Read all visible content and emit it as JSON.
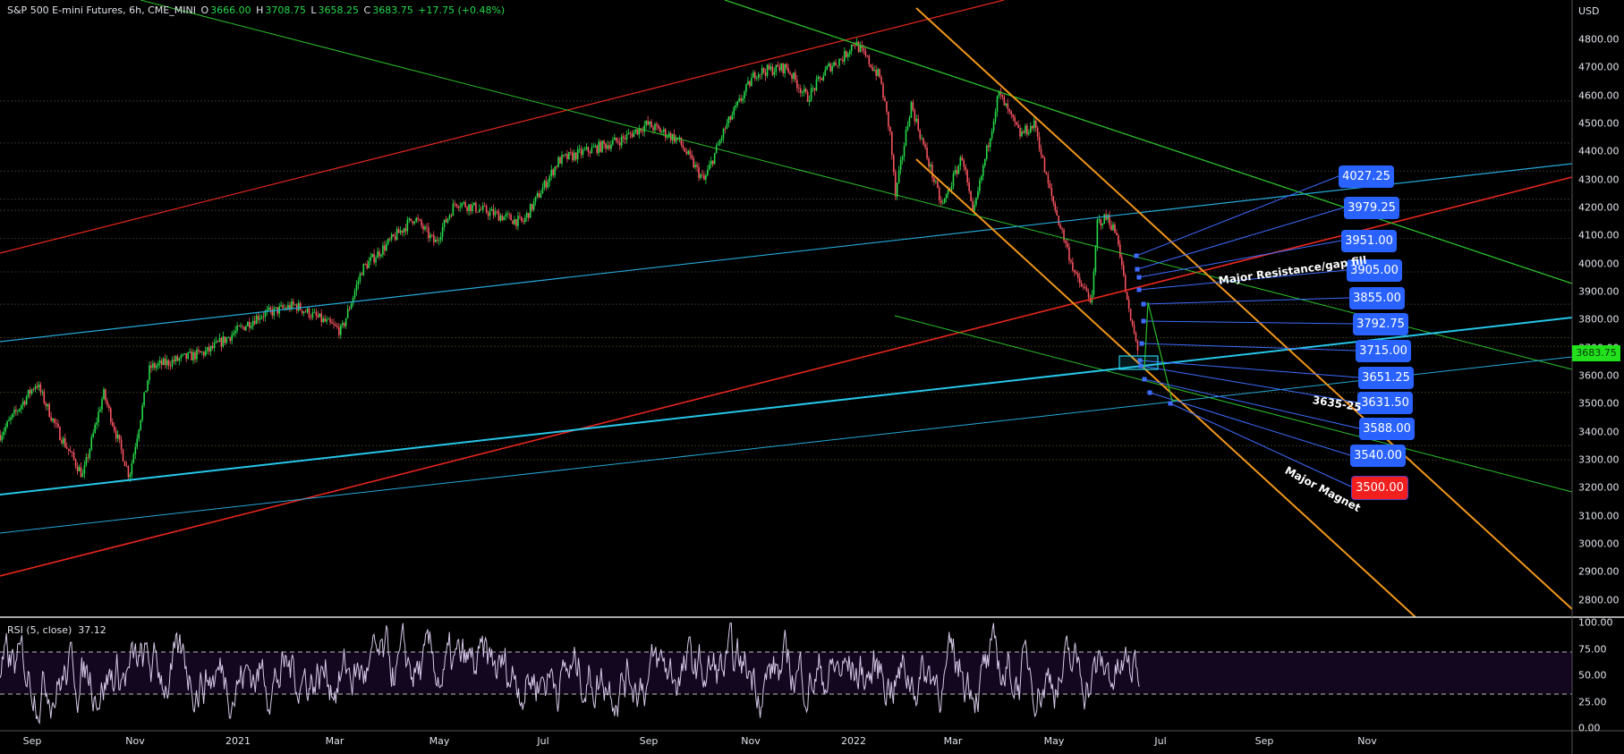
{
  "header": {
    "symbol": "S&P 500 E-mini Futures, 6h, CME_MINI",
    "o_label": "O",
    "o": "3666.00",
    "h_label": "H",
    "h": "3708.75",
    "l_label": "L",
    "l": "3658.25",
    "c_label": "C",
    "c": "3683.75",
    "change": "+17.75 (+0.48%)"
  },
  "price_axis": {
    "currency": "USD",
    "labels": [
      "4800.00",
      "4700.00",
      "4600.00",
      "4500.00",
      "4400.00",
      "4300.00",
      "4200.00",
      "4100.00",
      "4000.00",
      "3900.00",
      "3800.00",
      "3700.00",
      "3600.00",
      "3500.00",
      "3400.00",
      "3300.00",
      "3200.00",
      "3100.00",
      "3000.00",
      "2900.00",
      "2800.00"
    ],
    "current_price": "3683.75"
  },
  "rsi_axis": {
    "labels": [
      "100.00",
      "75.00",
      "50.00",
      "25.00",
      "0.00"
    ]
  },
  "time_axis": {
    "labels": [
      "Sep",
      "Nov",
      "2021",
      "Mar",
      "May",
      "Jul",
      "Sep",
      "Nov",
      "2022",
      "Mar",
      "May",
      "Jul",
      "Sep",
      "Nov"
    ]
  },
  "rsi": {
    "legend": "RSI (5, close)",
    "value": "37.12"
  },
  "price_boxes": [
    {
      "label": "4027.25",
      "color": "#2962ff"
    },
    {
      "label": "3979.25",
      "color": "#2962ff"
    },
    {
      "label": "3951.00",
      "color": "#2962ff"
    },
    {
      "label": "3905.00",
      "color": "#2962ff"
    },
    {
      "label": "3855.00",
      "color": "#2962ff"
    },
    {
      "label": "3792.75",
      "color": "#2962ff"
    },
    {
      "label": "3715.00",
      "color": "#2962ff"
    },
    {
      "label": "3651.25",
      "color": "#2962ff"
    },
    {
      "label": "3631.50",
      "color": "#2962ff"
    },
    {
      "label": "3588.00",
      "color": "#2962ff"
    },
    {
      "label": "3540.00",
      "color": "#2962ff"
    },
    {
      "label": "3500.00",
      "color": "#f21f1f"
    }
  ],
  "annotations": {
    "resistance": "Major Resistance/gap fill",
    "zone": "3635-25",
    "magnet": "Major Magnet"
  },
  "colors": {
    "up": "#26d94a",
    "down": "#f7525f",
    "rsi": "#d6c8e8",
    "band": "#12071f",
    "accent": "#2962ff"
  },
  "chart_data": {
    "type": "candlestick",
    "title": "S&P 500 E-mini Futures, 6h, CME_MINI",
    "ylabel": "USD",
    "ylim": [
      2750,
      4900
    ],
    "x_unit": "months since Sep 2020",
    "price_path": [
      [
        -0.62,
        3389
      ],
      [
        0.08,
        3574
      ],
      [
        0.48,
        3408
      ],
      [
        0.98,
        3242
      ],
      [
        1.38,
        3537
      ],
      [
        1.88,
        3242
      ],
      [
        2.28,
        3629
      ],
      [
        3.39,
        3685
      ],
      [
        4.39,
        3814
      ],
      [
        5.09,
        3851
      ],
      [
        5.99,
        3759
      ],
      [
        6.39,
        3980
      ],
      [
        7.4,
        4165
      ],
      [
        7.8,
        4073
      ],
      [
        8.2,
        4220
      ],
      [
        9.5,
        4146
      ],
      [
        10.2,
        4368
      ],
      [
        11.41,
        4442
      ],
      [
        11.91,
        4497
      ],
      [
        12.51,
        4442
      ],
      [
        13.01,
        4294
      ],
      [
        13.41,
        4479
      ],
      [
        14.01,
        4682
      ],
      [
        14.61,
        4700
      ],
      [
        15.01,
        4590
      ],
      [
        15.42,
        4700
      ],
      [
        15.72,
        4737
      ],
      [
        15.92,
        4793
      ],
      [
        16.42,
        4664
      ],
      [
        16.62,
        4460
      ],
      [
        16.72,
        4239
      ],
      [
        17.02,
        4571
      ],
      [
        17.62,
        4202
      ],
      [
        18.02,
        4386
      ],
      [
        18.22,
        4165
      ],
      [
        18.72,
        4608
      ],
      [
        18.92,
        4534
      ],
      [
        19.13,
        4460
      ],
      [
        19.43,
        4497
      ],
      [
        19.63,
        4313
      ],
      [
        19.83,
        4183
      ],
      [
        20.23,
        3943
      ],
      [
        20.53,
        3869
      ],
      [
        20.63,
        4146
      ],
      [
        20.83,
        4165
      ],
      [
        21.03,
        4091
      ],
      [
        21.23,
        3832
      ],
      [
        21.43,
        3683.75
      ]
    ],
    "rsi": {
      "period": 5,
      "overbought": 70,
      "oversold": 30,
      "ylim": [
        0,
        100
      ],
      "last": 37.12
    }
  }
}
